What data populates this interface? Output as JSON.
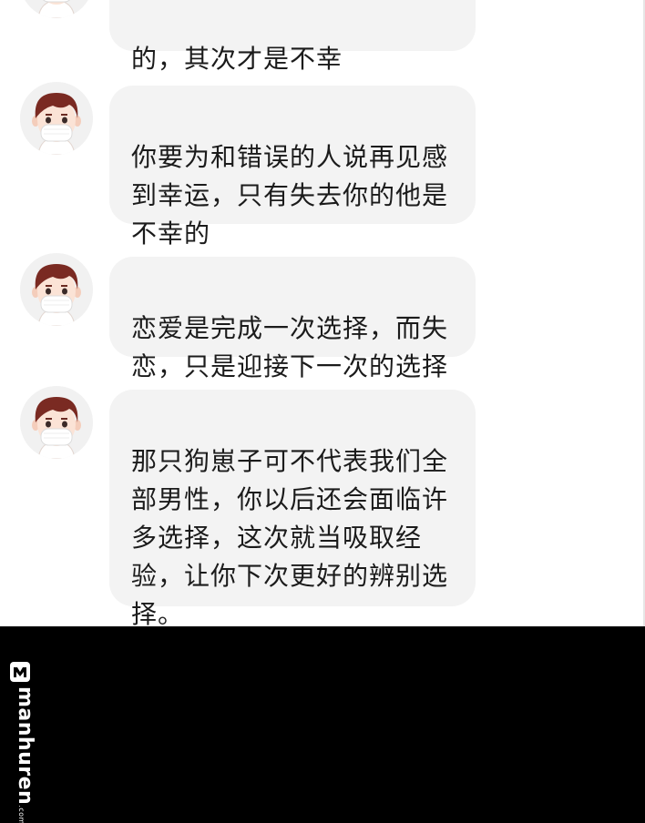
{
  "messages": [
    {
      "text": "的，其次才是不幸"
    },
    {
      "text": "你要为和错误的人说再见感\n到幸运，只有失去你的他是\n不幸的"
    },
    {
      "text": "恋爱是完成一次选择，而失\n恋，只是迎接下一次的选择"
    },
    {
      "text": "那只狗崽子可不代表我们全\n部男性，你以后还会面临许\n多选择，这次就当吸取经\n验，让你下次更好的辨别选\n择。"
    }
  ],
  "watermark": {
    "text": "manhuren",
    "suffix": ".com"
  },
  "colors": {
    "bubble": "#f3f3f3",
    "text": "#1b1b1b",
    "footer": "#000000",
    "hair": "#7a2a22",
    "mask": "#ffffff"
  }
}
